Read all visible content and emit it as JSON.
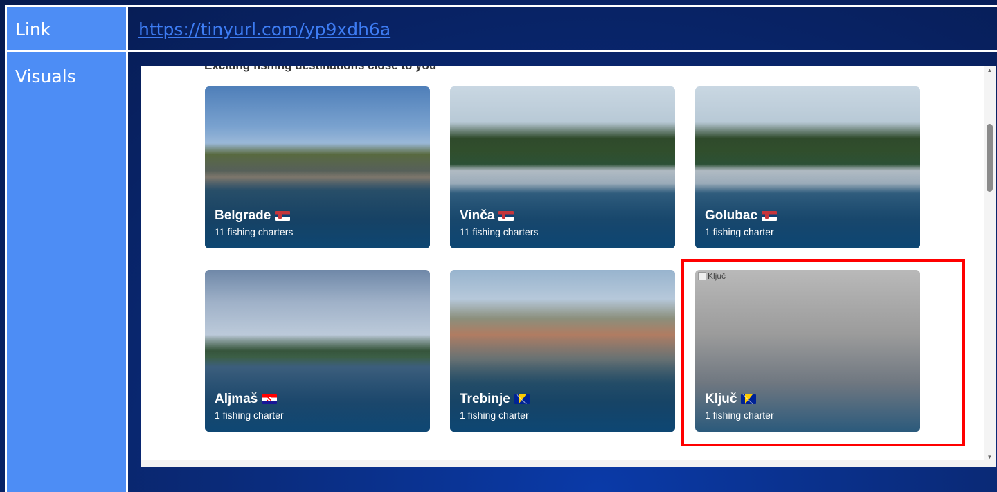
{
  "table": {
    "rows": [
      {
        "label": "Link",
        "value": "https://tinyurl.com/yp9xdh6a"
      },
      {
        "label": "Visuals"
      }
    ]
  },
  "screenshot": {
    "heading": "Exciting fishing destinations close to you",
    "cards": [
      {
        "name": "Belgrade",
        "count": "11 fishing charters",
        "flag": "serbia-flag"
      },
      {
        "name": "Vinča",
        "count": "11 fishing charters",
        "flag": "serbia-flag"
      },
      {
        "name": "Golubac",
        "count": "1 fishing charter",
        "flag": "serbia-flag"
      },
      {
        "name": "Aljmaš",
        "count": "1 fishing charter",
        "flag": "croatia-flag"
      },
      {
        "name": "Trebinje",
        "count": "1 fishing charter",
        "flag": "bosnia-flag"
      },
      {
        "name": "Ključ",
        "count": "1 fishing charter",
        "flag": "bosnia-flag",
        "broken_image_alt": "Ključ"
      }
    ]
  },
  "colors": {
    "label_column": "#4d8df5",
    "link": "#3d7cf3",
    "highlight": "#ff0000",
    "background": "#0a2a78"
  }
}
